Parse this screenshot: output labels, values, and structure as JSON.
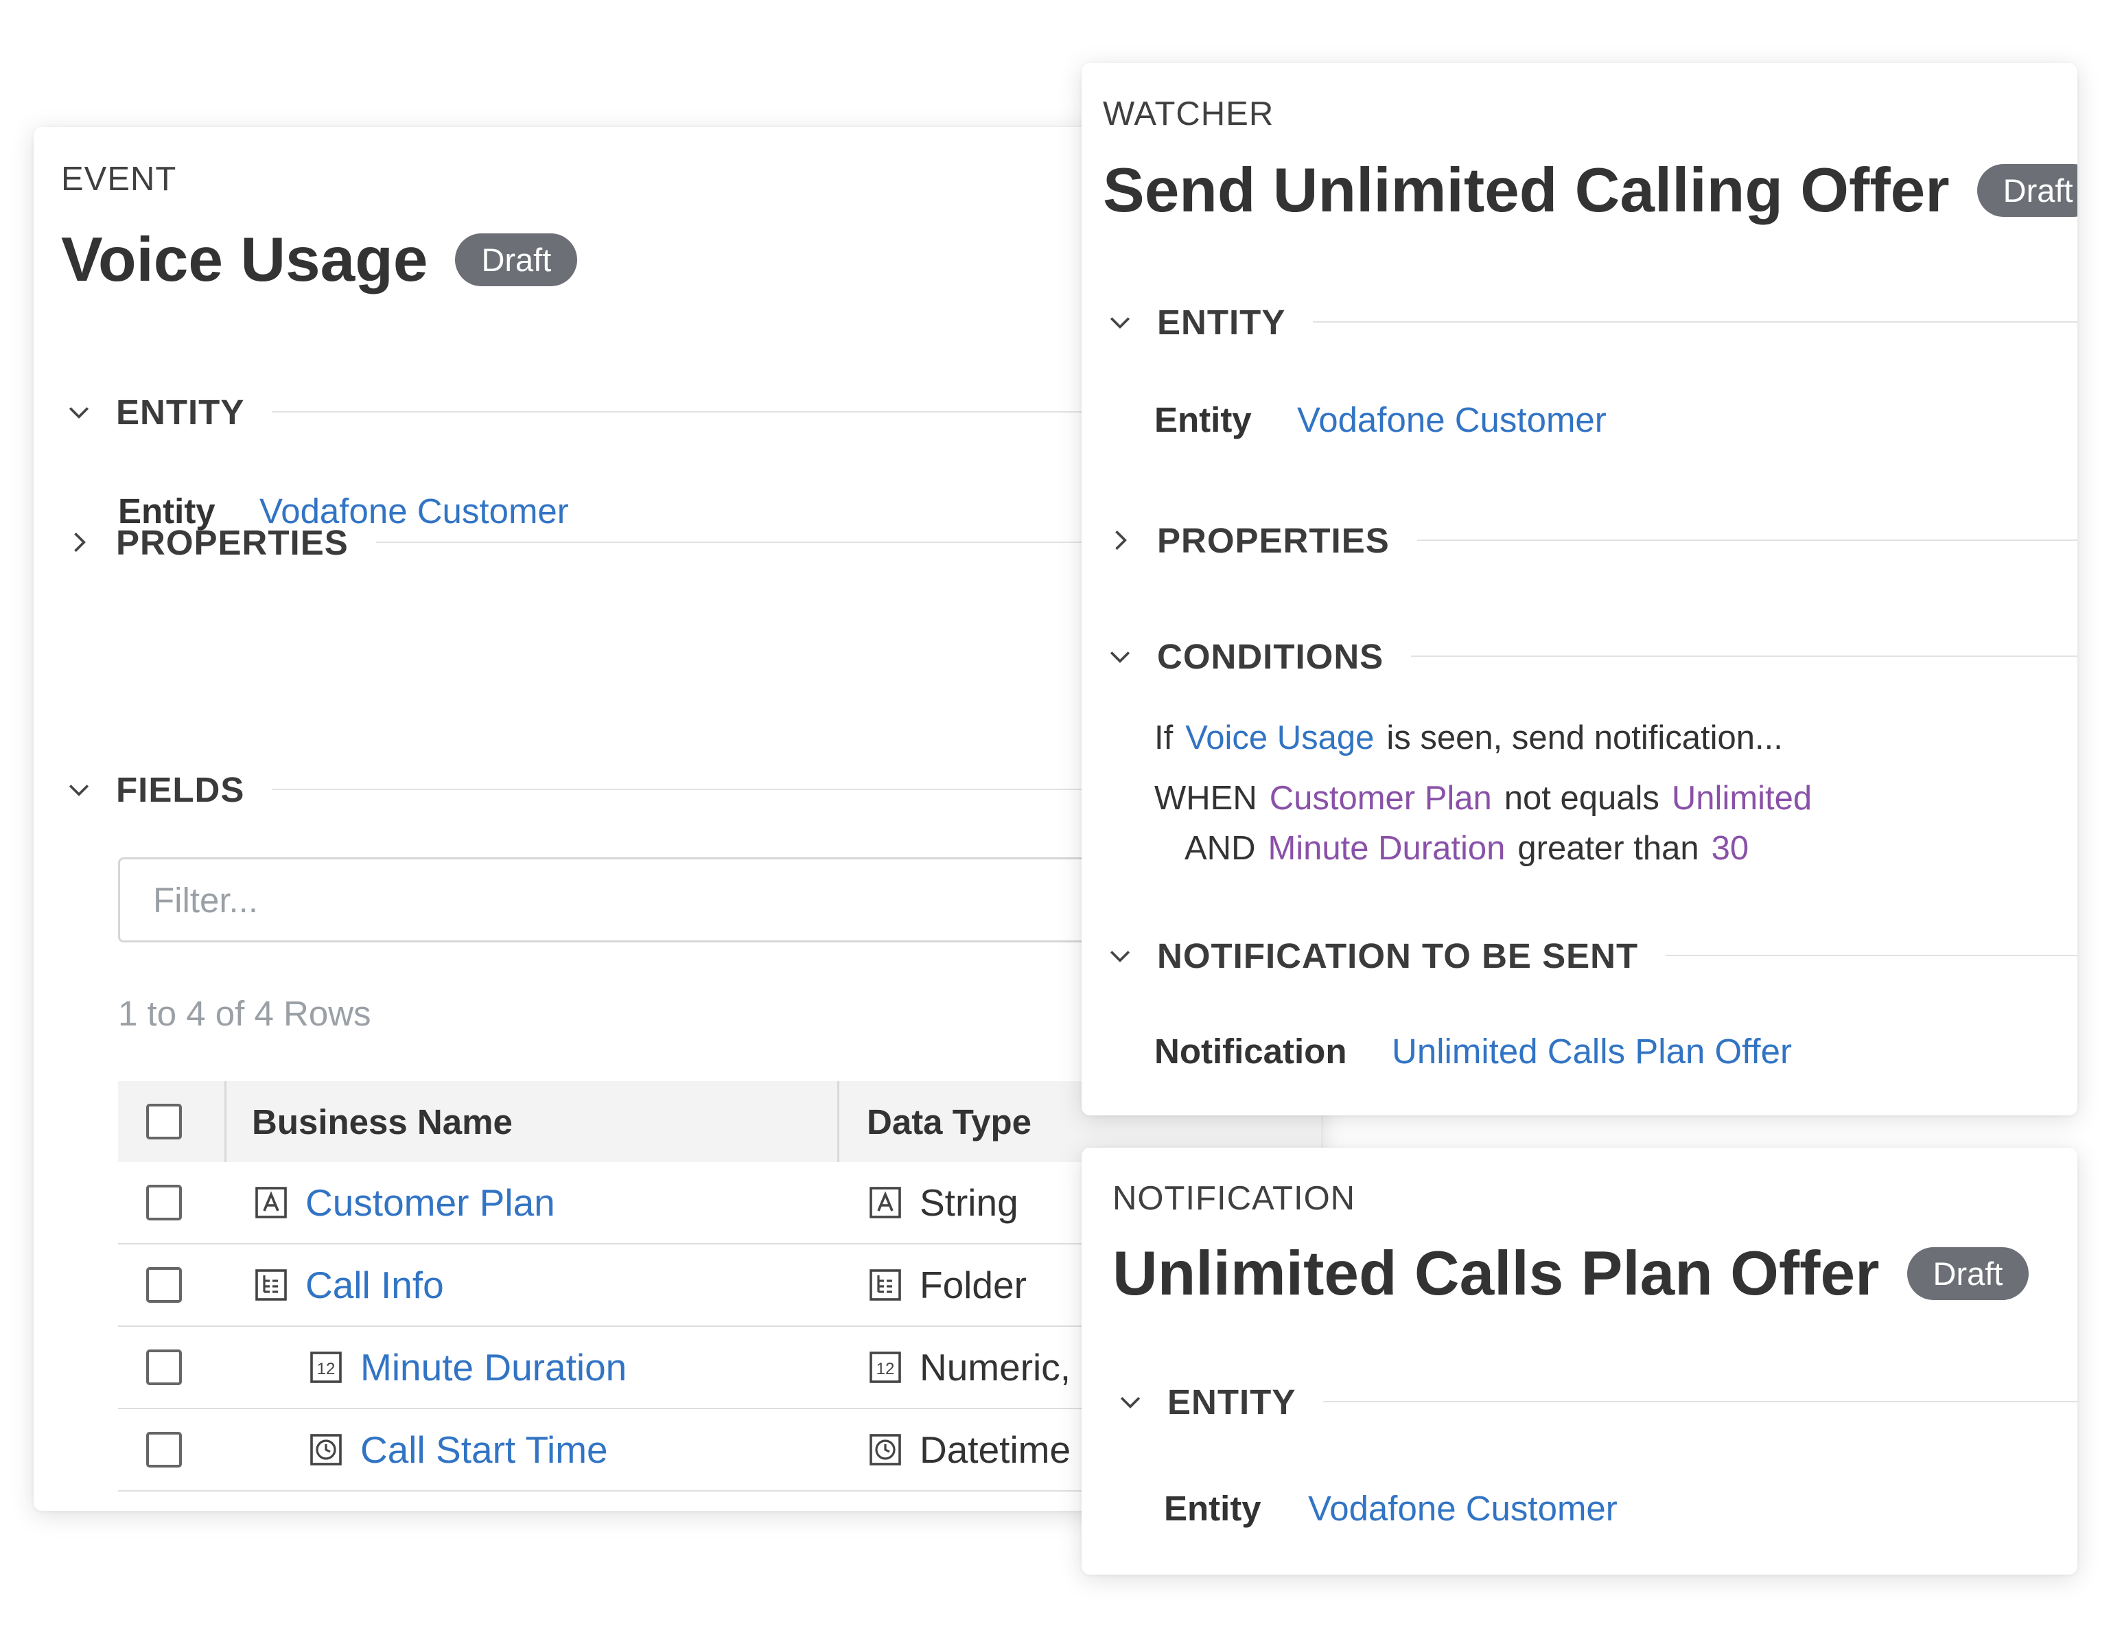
{
  "event": {
    "kicker": "EVENT",
    "title": "Voice Usage",
    "badge": "Draft",
    "entity_section": {
      "title": "ENTITY",
      "label": "Entity",
      "value": "Vodafone Customer"
    },
    "properties_section": {
      "title": "PROPERTIES"
    },
    "fields_section": {
      "title": "FIELDS"
    },
    "filter_placeholder": "Filter...",
    "rows_summary": "1 to 4 of 4 Rows",
    "table": {
      "columns": [
        "Business Name",
        "Data Type"
      ],
      "rows": [
        {
          "name": "Customer Plan",
          "icon": "text-type-icon",
          "type": "String",
          "type_icon": "text-type-icon"
        },
        {
          "name": "Call Info",
          "icon": "folder-type-icon",
          "type": "Folder",
          "type_icon": "folder-type-icon"
        },
        {
          "name": "Minute Duration",
          "icon": "numeric-type-icon",
          "type": "Numeric, ",
          "type_icon": "numeric-type-icon"
        },
        {
          "name": "Call Start Time",
          "icon": "clock-type-icon",
          "type": "Datetime",
          "type_icon": "clock-type-icon"
        }
      ]
    }
  },
  "watcher": {
    "kicker": "WATCHER",
    "title": "Send Unlimited Calling Offer",
    "badge": "Draft",
    "entity_section": {
      "title": "ENTITY",
      "label": "Entity",
      "value": "Vodafone Customer"
    },
    "properties_section": {
      "title": "PROPERTIES"
    },
    "conditions_section": {
      "title": "CONDITIONS",
      "line1": {
        "if": "If",
        "event": "Voice Usage",
        "rest": "is seen, send notification..."
      },
      "line2": {
        "kw": "WHEN",
        "field": "Customer Plan",
        "op": "not equals",
        "value": "Unlimited"
      },
      "line3": {
        "kw": "AND",
        "field": "Minute Duration",
        "op": "greater than",
        "value": "30"
      }
    },
    "notification_section": {
      "title": "NOTIFICATION TO BE SENT",
      "label": "Notification",
      "value": "Unlimited Calls Plan Offer"
    }
  },
  "notification": {
    "kicker": "NOTIFICATION",
    "title": "Unlimited Calls Plan Offer",
    "badge": "Draft",
    "entity_section": {
      "title": "ENTITY",
      "label": "Entity",
      "value": "Vodafone Customer"
    }
  },
  "colors": {
    "link": "#3274c4",
    "condition_value": "#8a51a8",
    "badge": "#6c6f76"
  }
}
